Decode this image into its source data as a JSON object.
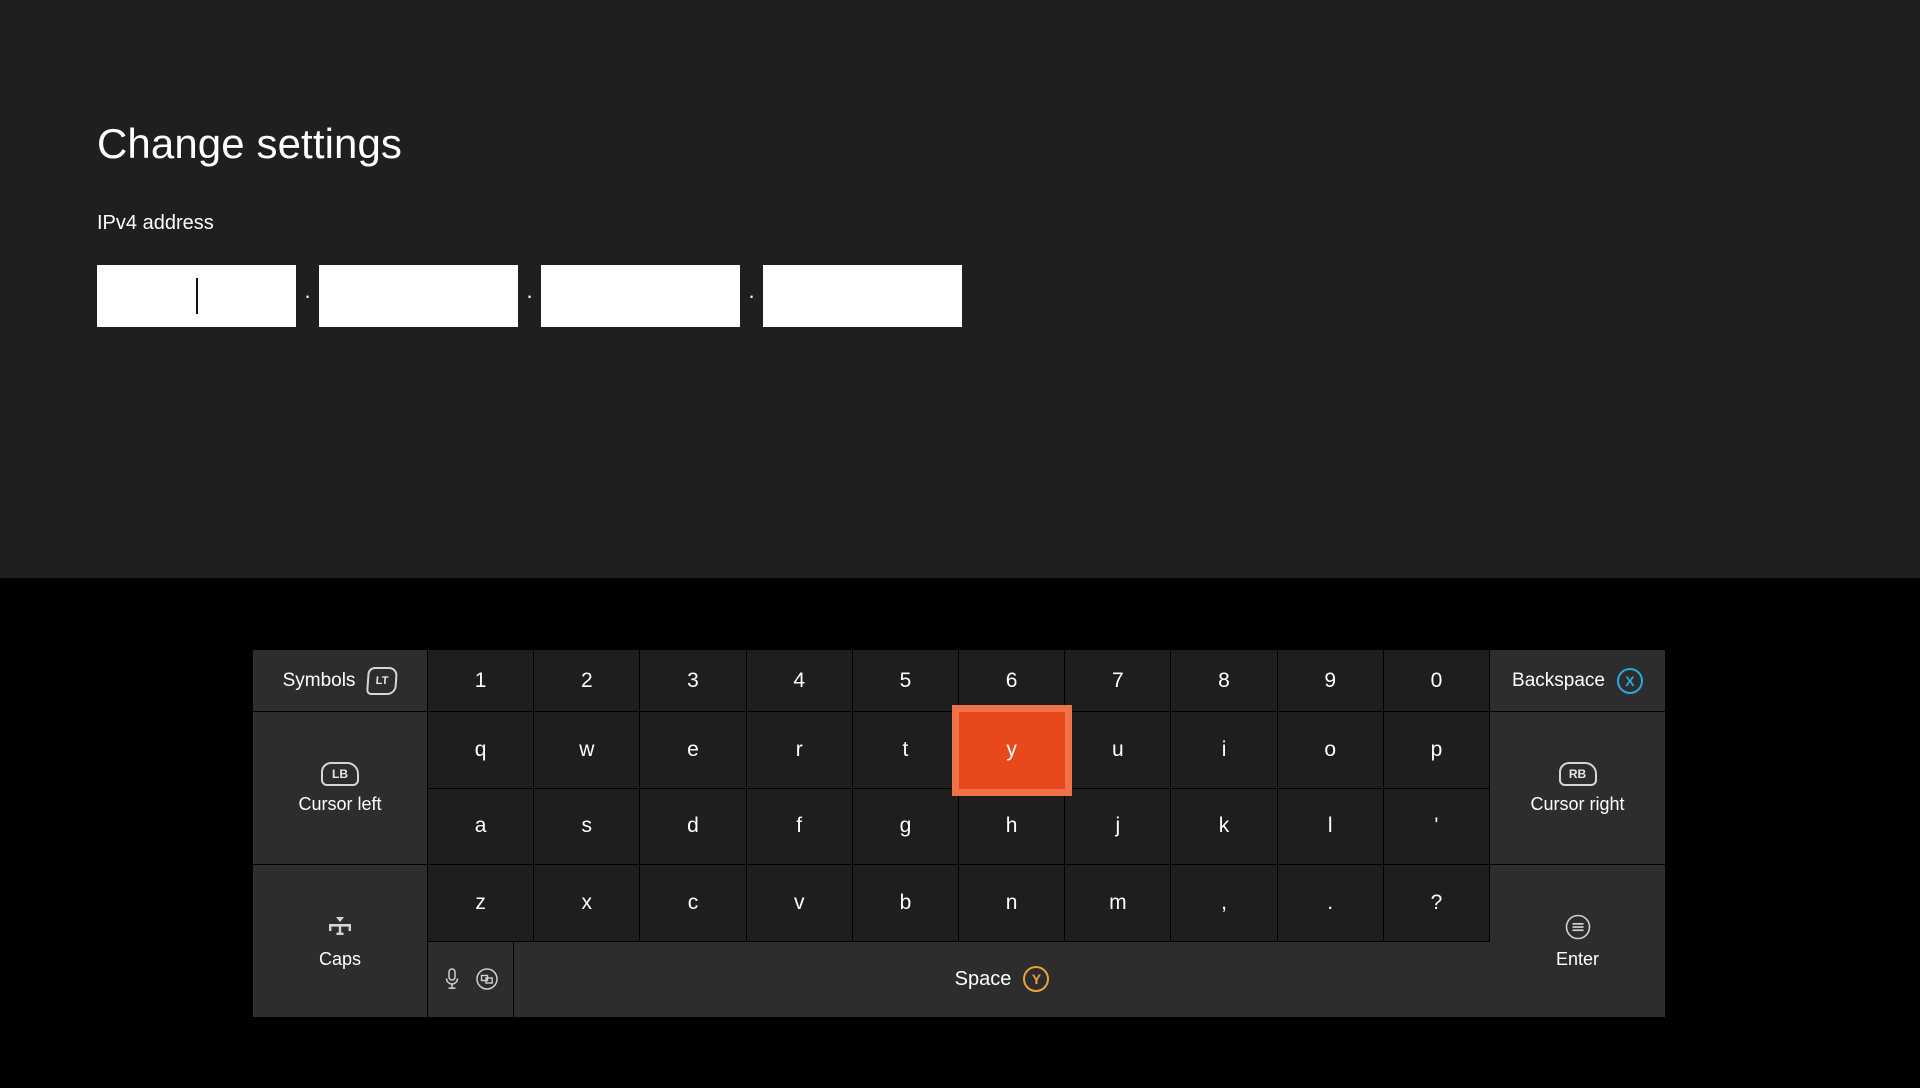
{
  "screen": {
    "background": "#000000",
    "panel_background": "#1f1f1f",
    "accent_highlight": "#e8491c",
    "accent_highlight_ring": "#ef7248"
  },
  "settings": {
    "title": "Change settings",
    "field_label": "IPv4 address",
    "octet_separator": ".",
    "octets": [
      {
        "value": "",
        "placeholder": "",
        "focused": true
      },
      {
        "value": "",
        "placeholder": "",
        "focused": false
      },
      {
        "value": "",
        "placeholder": "",
        "focused": false
      },
      {
        "value": "",
        "placeholder": "",
        "focused": false
      }
    ]
  },
  "keyboard": {
    "left_column": [
      {
        "id": "symbols",
        "label": "Symbols",
        "glyph": "trigger-lt-icon",
        "glyph_text": "LT"
      },
      {
        "id": "cursor-left",
        "label": "Cursor left",
        "glyph": "bumper-lb-icon",
        "glyph_text": "LB"
      },
      {
        "id": "caps",
        "label": "Caps",
        "glyph": "caps-icon",
        "glyph_text": ""
      }
    ],
    "right_column": [
      {
        "id": "backspace",
        "label": "Backspace",
        "glyph": "xbox-x-button-icon",
        "glyph_text": "X",
        "glyph_color": "#2aa8e0"
      },
      {
        "id": "cursor-right",
        "label": "Cursor right",
        "glyph": "bumper-rb-icon",
        "glyph_text": "RB"
      },
      {
        "id": "enter",
        "label": "Enter",
        "glyph": "xbox-menu-button-icon",
        "glyph_text": ""
      }
    ],
    "rows": {
      "numbers": [
        "1",
        "2",
        "3",
        "4",
        "5",
        "6",
        "7",
        "8",
        "9",
        "0"
      ],
      "top_letters": [
        "q",
        "w",
        "e",
        "r",
        "t",
        "y",
        "u",
        "i",
        "o",
        "p"
      ],
      "home_letters": [
        "a",
        "s",
        "d",
        "f",
        "g",
        "h",
        "j",
        "k",
        "l",
        "'"
      ],
      "bottom_letters": [
        "z",
        "x",
        "c",
        "v",
        "b",
        "n",
        "m",
        ",",
        ".",
        "?"
      ]
    },
    "highlighted_key": "y",
    "spacebar": {
      "label": "Space",
      "glyph": "xbox-y-button-icon",
      "glyph_text": "Y",
      "glyph_color": "#e8a33d"
    },
    "input_icons": [
      {
        "id": "microphone",
        "name": "microphone-icon"
      },
      {
        "id": "view",
        "name": "xbox-view-button-icon"
      }
    ]
  }
}
